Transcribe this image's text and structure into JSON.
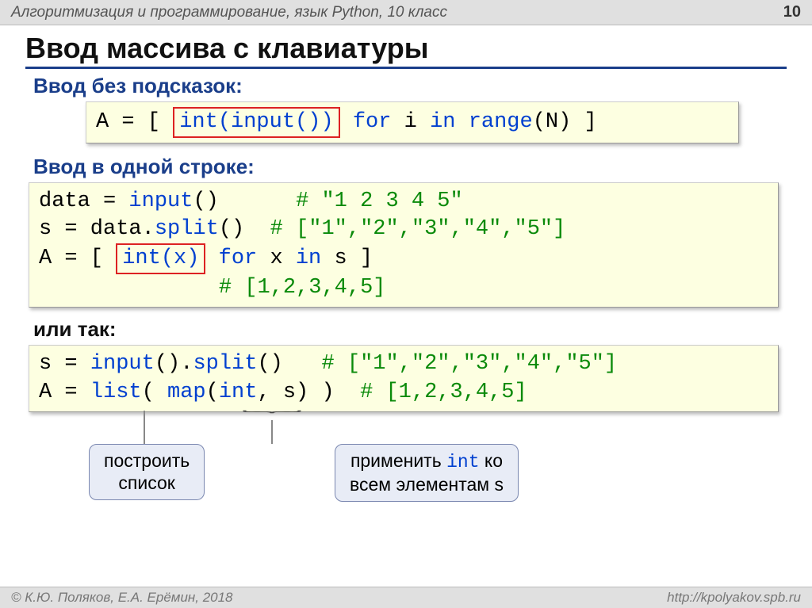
{
  "header": {
    "course": "Алгоритмизация и программирование, язык Python, 10 класс",
    "page": "10"
  },
  "title": "Ввод массива с клавиатуры",
  "sec1": {
    "label": "Ввод без подсказок:",
    "code_pre": "A = [ ",
    "code_box": "int(input())",
    "code_post": " for i in range(N) ]",
    "kw_for": "for",
    "kw_in": "in",
    "fn_range": "range"
  },
  "sec2": {
    "label": "Ввод в одной строке:",
    "l1a": "data = ",
    "l1b": "input",
    "l1c": "()      ",
    "l1d": "# \"1 2 3 4 5\"",
    "l2a": "s = data.",
    "l2b": "split",
    "l2c": "()  ",
    "l2d": "# [\"1\",\"2\",\"3\",\"4\",\"5\"]",
    "l3a": "A = [ ",
    "l3box": "int(x)",
    "l3b": " for",
    "l3c": " x ",
    "l3d": "in",
    "l3e": " s ]",
    "l4": "              # [1,2,3,4,5]"
  },
  "sec3": {
    "label": "или так:",
    "l1a": "s = ",
    "l1b": "input",
    "l1c": "().",
    "l1d": "split",
    "l1e": "()   ",
    "l1f": "# [\"1\",\"2\",\"3\",\"4\",\"5\"]",
    "l2a": "A = ",
    "l2b": "list",
    "l2c": "( ",
    "l2d": "map",
    "l2e": "(",
    "l2f": "int",
    "l2g": ", s) )  ",
    "l2h": "# [1,2,3,4,5]"
  },
  "callouts": {
    "c1_l1": "построить",
    "c1_l2": "список",
    "c2_l1a": "применить ",
    "c2_l1b": "int",
    "c2_l1c": " ко",
    "c2_l2": "всем элементам s"
  },
  "footer": {
    "left": "© К.Ю. Поляков, Е.А. Ерёмин, 2018",
    "right": "http://kpolyakov.spb.ru"
  }
}
